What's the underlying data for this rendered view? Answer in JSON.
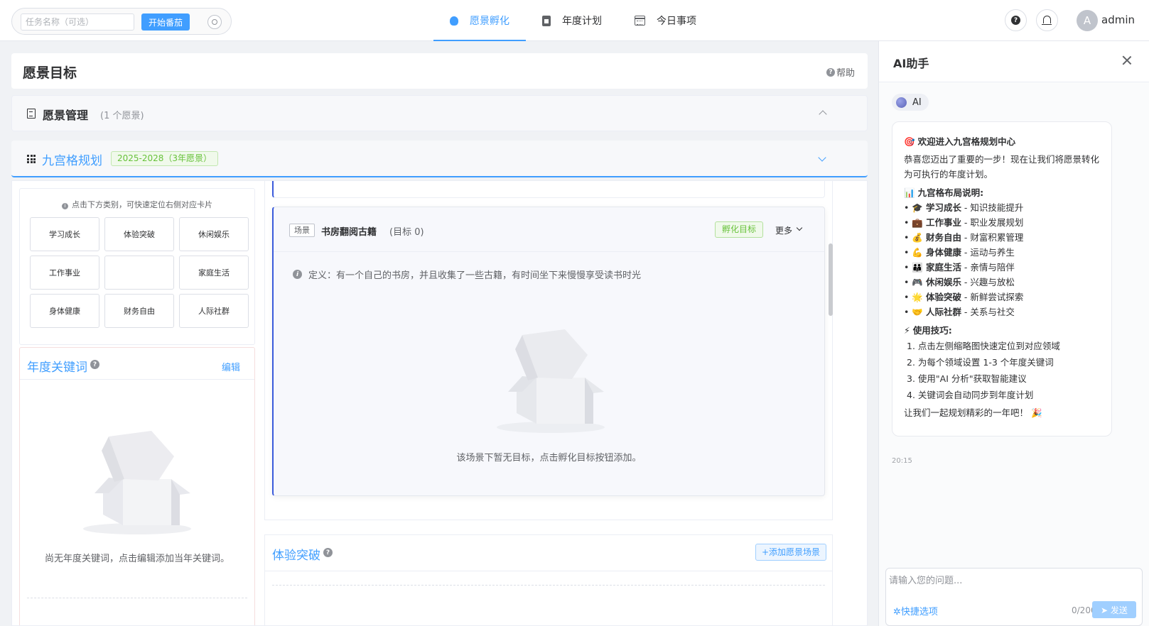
{
  "topbar": {
    "pomodoro": {
      "task_placeholder": "任务名称（可选）",
      "start_label": "开始番茄"
    },
    "tabs": [
      {
        "label": "愿景孵化",
        "icon": "bulb-icon",
        "active": true
      },
      {
        "label": "年度计划",
        "icon": "clipboard-icon",
        "active": false
      },
      {
        "label": "今日事项",
        "icon": "calendar-icon",
        "active": false
      }
    ],
    "help_icon": "?",
    "user": {
      "avatar_letter": "A",
      "name": "admin"
    }
  },
  "page": {
    "title": "愿景目标",
    "help_label": "帮助",
    "vision_mgmt": {
      "title": "愿景管理",
      "count": "(1 个愿景)"
    },
    "grid_plan": {
      "title": "九宫格规划",
      "tag": "2025-2028（3年愿景）"
    }
  },
  "mini_grid": {
    "hint": "点击下方类别，可快速定位右侧对应卡片",
    "cells": [
      "学习成长",
      "体验突破",
      "休闲娱乐",
      "工作事业",
      "",
      "家庭生活",
      "身体健康",
      "财务自由",
      "人际社群"
    ]
  },
  "keywords": {
    "title": "年度关键词",
    "edit_label": "编辑",
    "empty_text": "尚无年度关键词，点击编辑添加当年关键词。"
  },
  "scene": {
    "tag": "场景",
    "name": "书房翻阅古籍",
    "goal_count": "(目标 0)",
    "hatch_label": "孵化目标",
    "more_label": "更多",
    "definition": "定义：有一个自己的书房，并且收集了一些古籍，有时间坐下来慢慢享受读书时光",
    "empty_text": "该场景下暂无目标，点击孵化目标按钮添加。"
  },
  "experience_section": {
    "title": "体验突破",
    "add_label": "+添加愿景场景"
  },
  "ai": {
    "title": "AI助手",
    "badge": "AI",
    "message": {
      "welcome": "欢迎进入九宫格规划中心",
      "intro": "恭喜您迈出了重要的一步！现在让我们将愿景转化为可执行的年度计划。",
      "layout_title": "九宫格布局说明:",
      "items": [
        {
          "emoji": "🎓",
          "name": "学习成长",
          "desc": " - 知识技能提升"
        },
        {
          "emoji": "💼",
          "name": "工作事业",
          "desc": " - 职业发展规划"
        },
        {
          "emoji": "💰",
          "name": "财务自由",
          "desc": " - 财富积累管理"
        },
        {
          "emoji": "💪",
          "name": "身体健康",
          "desc": " - 运动与养生"
        },
        {
          "emoji": "👪",
          "name": "家庭生活",
          "desc": " - 亲情与陪伴"
        },
        {
          "emoji": "🎮",
          "name": "休闲娱乐",
          "desc": " - 兴趣与放松"
        },
        {
          "emoji": "🌟",
          "name": "体验突破",
          "desc": " - 新鲜尝试探索"
        },
        {
          "emoji": "🤝",
          "name": "人际社群",
          "desc": " - 关系与社交"
        }
      ],
      "tips_title": "使用技巧:",
      "tips": [
        "1. 点击左侧缩略图快速定位到对应领域",
        "2. 为每个领域设置 1-3 个年度关键词",
        "3. 使用\"AI 分析\"获取智能建议",
        "4. 关键词会自动同步到年度计划"
      ],
      "closing": "让我们一起规划精彩的一年吧！"
    },
    "time": "20:15",
    "input_placeholder": "请输入您的问题...",
    "quick_label": "快捷选项",
    "char_count": "0/200",
    "send_label": "发送"
  }
}
